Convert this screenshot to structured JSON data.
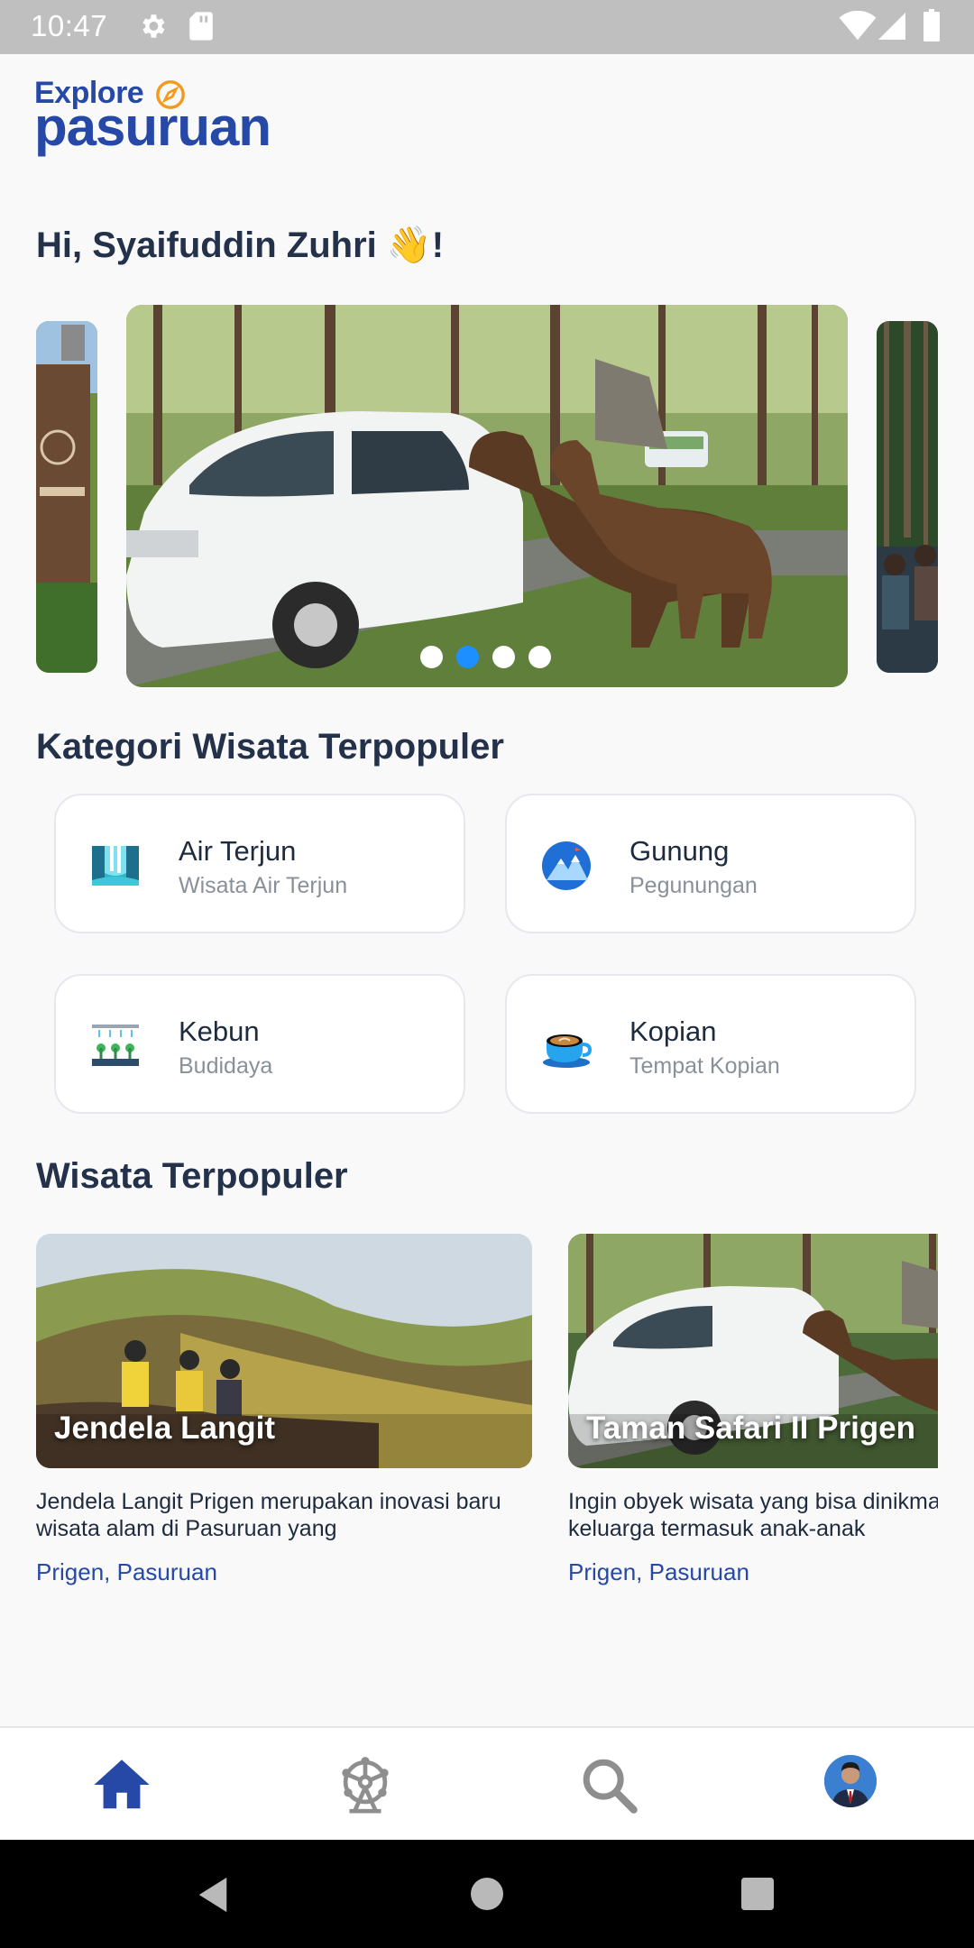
{
  "status_bar": {
    "time": "10:47"
  },
  "app": {
    "logo_line1": "Explore",
    "logo_line2": "pasuruan",
    "brand_color": "#2649a8"
  },
  "greeting": "Hi, Syaifuddin Zuhri ",
  "greeting_emoji": "👋",
  "greeting_end": "!",
  "carousel": {
    "slides": 4,
    "active_index": 1
  },
  "categories": {
    "title": "Kategori Wisata Terpopuler",
    "items": [
      {
        "title": "Air Terjun",
        "subtitle": "Wisata Air Terjun",
        "icon": "waterfall-icon"
      },
      {
        "title": "Gunung",
        "subtitle": "Pegunungan",
        "icon": "mountain-icon"
      },
      {
        "title": "Kebun",
        "subtitle": "Budidaya",
        "icon": "garden-icon"
      },
      {
        "title": "Kopian",
        "subtitle": "Tempat Kopian",
        "icon": "coffee-icon"
      }
    ]
  },
  "popular": {
    "title": "Wisata Terpopuler",
    "items": [
      {
        "name": "Jendela Langit",
        "desc": "Jendela Langit Prigen merupakan inovasi baru wisata alam di Pasuruan yang",
        "location": "Prigen, Pasuruan"
      },
      {
        "name": "Taman Safari II Prigen",
        "desc": "Ingin obyek wisata yang bisa dinikmati seluruh keluarga termasuk anak-anak",
        "location": "Prigen, Pasuruan"
      }
    ]
  },
  "bottom_nav": {
    "items": [
      "home-icon",
      "ferris-wheel-icon",
      "search-icon",
      "profile-avatar"
    ],
    "active_color": "#2649a8",
    "inactive_color": "#8e8e8e"
  }
}
